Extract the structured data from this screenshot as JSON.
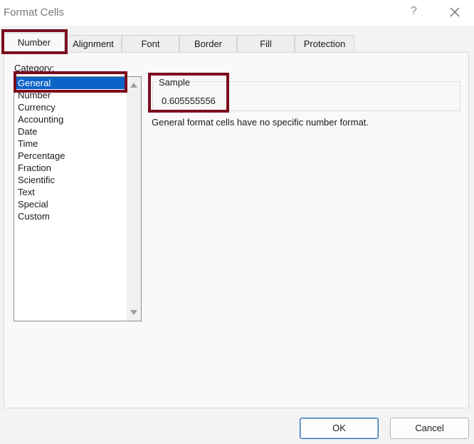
{
  "window": {
    "title": "Format Cells",
    "help_label": "?"
  },
  "tabs": [
    {
      "label": "Number",
      "active": true
    },
    {
      "label": "Alignment",
      "active": false
    },
    {
      "label": "Font",
      "active": false
    },
    {
      "label": "Border",
      "active": false
    },
    {
      "label": "Fill",
      "active": false
    },
    {
      "label": "Protection",
      "active": false
    }
  ],
  "number_tab": {
    "category_label": "Category:",
    "categories": [
      "General",
      "Number",
      "Currency",
      "Accounting",
      "Date",
      "Time",
      "Percentage",
      "Fraction",
      "Scientific",
      "Text",
      "Special",
      "Custom"
    ],
    "selected_category": "General",
    "sample_label": "Sample",
    "sample_value": "0.605555556",
    "description": "General format cells have no specific number format."
  },
  "buttons": {
    "ok": "OK",
    "cancel": "Cancel"
  },
  "colors": {
    "selection": "#0a64c8",
    "highlight_box": "#7b0d1e",
    "primary_button_border": "#2d6fb7"
  }
}
